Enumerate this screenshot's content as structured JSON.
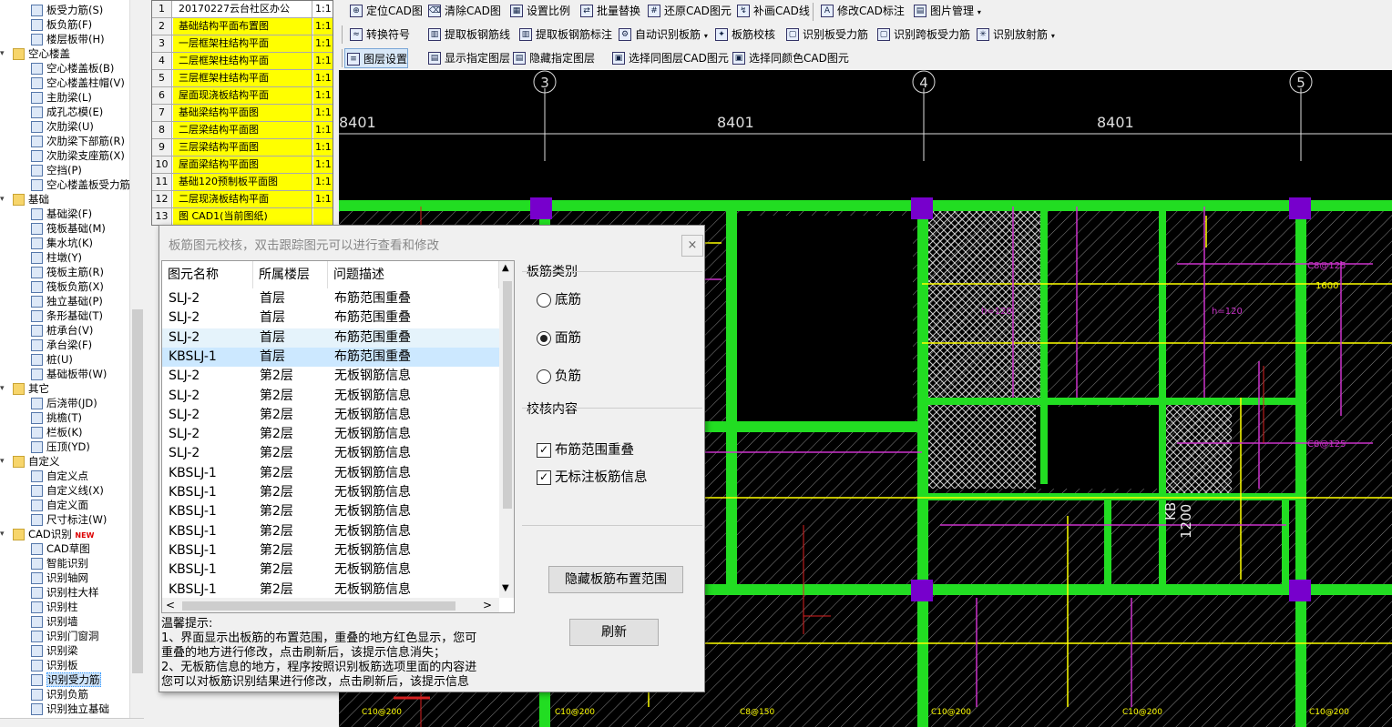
{
  "tree": [
    {
      "label": "板受力筋(S)",
      "indent": 2
    },
    {
      "label": "板负筋(F)",
      "indent": 2
    },
    {
      "label": "楼层板带(H)",
      "indent": 2
    },
    {
      "label": "空心楼盖",
      "indent": 1,
      "cat": true
    },
    {
      "label": "空心楼盖板(B)",
      "indent": 2
    },
    {
      "label": "空心楼盖柱帽(V)",
      "indent": 2
    },
    {
      "label": "主肋梁(L)",
      "indent": 2
    },
    {
      "label": "成孔芯模(E)",
      "indent": 2
    },
    {
      "label": "次肋梁(U)",
      "indent": 2
    },
    {
      "label": "次肋梁下部筋(R)",
      "indent": 2
    },
    {
      "label": "次肋梁支座筋(X)",
      "indent": 2
    },
    {
      "label": "空挡(P)",
      "indent": 2
    },
    {
      "label": "空心楼盖板受力筋",
      "indent": 2
    },
    {
      "label": "基础",
      "indent": 1,
      "cat": true
    },
    {
      "label": "基础梁(F)",
      "indent": 2
    },
    {
      "label": "筏板基础(M)",
      "indent": 2
    },
    {
      "label": "集水坑(K)",
      "indent": 2
    },
    {
      "label": "柱墩(Y)",
      "indent": 2
    },
    {
      "label": "筏板主筋(R)",
      "indent": 2
    },
    {
      "label": "筏板负筋(X)",
      "indent": 2
    },
    {
      "label": "独立基础(P)",
      "indent": 2
    },
    {
      "label": "条形基础(T)",
      "indent": 2
    },
    {
      "label": "桩承台(V)",
      "indent": 2
    },
    {
      "label": "承台梁(F)",
      "indent": 2
    },
    {
      "label": "桩(U)",
      "indent": 2
    },
    {
      "label": "基础板带(W)",
      "indent": 2
    },
    {
      "label": "其它",
      "indent": 1,
      "cat": true
    },
    {
      "label": "后浇带(JD)",
      "indent": 2
    },
    {
      "label": "挑檐(T)",
      "indent": 2
    },
    {
      "label": "栏板(K)",
      "indent": 2
    },
    {
      "label": "压顶(YD)",
      "indent": 2
    },
    {
      "label": "自定义",
      "indent": 1,
      "cat": true
    },
    {
      "label": "自定义点",
      "indent": 2
    },
    {
      "label": "自定义线(X)",
      "indent": 2
    },
    {
      "label": "自定义面",
      "indent": 2
    },
    {
      "label": "尺寸标注(W)",
      "indent": 2
    },
    {
      "label": "CAD识别",
      "indent": 1,
      "cat": true,
      "badge": "NEW"
    },
    {
      "label": "CAD草图",
      "indent": 2
    },
    {
      "label": "智能识别",
      "indent": 2
    },
    {
      "label": "识别轴网",
      "indent": 2
    },
    {
      "label": "识别柱大样",
      "indent": 2
    },
    {
      "label": "识别柱",
      "indent": 2
    },
    {
      "label": "识别墙",
      "indent": 2
    },
    {
      "label": "识别门窗洞",
      "indent": 2
    },
    {
      "label": "识别梁",
      "indent": 2
    },
    {
      "label": "识别板",
      "indent": 2
    },
    {
      "label": "识别受力筋",
      "indent": 2,
      "selected": true
    },
    {
      "label": "识别负筋",
      "indent": 2
    },
    {
      "label": "识别独立基础",
      "indent": 2
    }
  ],
  "drawings": [
    {
      "n": "1",
      "name": "20170227云台社区办公",
      "scale": "1:1",
      "header": true
    },
    {
      "n": "2",
      "name": "基础结构平面布置图",
      "scale": "1:1"
    },
    {
      "n": "3",
      "name": "一层框架柱结构平面",
      "scale": "1:1"
    },
    {
      "n": "4",
      "name": "二层框架柱结构平面",
      "scale": "1:1"
    },
    {
      "n": "5",
      "name": "三层框架柱结构平面",
      "scale": "1:1"
    },
    {
      "n": "6",
      "name": "屋面现浇板结构平面",
      "scale": "1:1"
    },
    {
      "n": "7",
      "name": "基础梁结构平面图",
      "scale": "1:1"
    },
    {
      "n": "8",
      "name": "二层梁结构平面图",
      "scale": "1:1"
    },
    {
      "n": "9",
      "name": "三层梁结构平面图",
      "scale": "1:1"
    },
    {
      "n": "10",
      "name": "屋面梁结构平面图",
      "scale": "1:1"
    },
    {
      "n": "11",
      "name": "基础120预制板平面图",
      "scale": "1:1"
    },
    {
      "n": "12",
      "name": "二层现浇板结构平面",
      "scale": "1:1"
    },
    {
      "n": "13",
      "name": "图 CAD1(当前图纸)",
      "scale": ""
    }
  ],
  "toolbar": {
    "row1": [
      "定位CAD图",
      "清除CAD图",
      "设置比例",
      "批量替换",
      "还原CAD图元",
      "补画CAD线",
      "修改CAD标注",
      "图片管理"
    ],
    "row2": [
      "转换符号",
      "提取板钢筋线",
      "提取板钢筋标注",
      "自动识别板筋",
      "板筋校核",
      "识别板受力筋",
      "识别跨板受力筋",
      "识别放射筋"
    ],
    "row3": [
      "图层设置",
      "显示指定图层",
      "隐藏指定图层",
      "选择同图层CAD图元",
      "选择同颜色CAD图元"
    ]
  },
  "cad": {
    "axes": [
      "3",
      "4",
      "5"
    ],
    "dims": [
      "8401",
      "8401",
      "8401"
    ],
    "labels": [
      "h=120",
      "h=120",
      "C8@125",
      "C8@125",
      "1600",
      "KB",
      "1200",
      "C10@200",
      "C10@200",
      "C8@150",
      "C10@200",
      "C10@200",
      "C10@200"
    ]
  },
  "dialog": {
    "title": "板筋图元校核，双击跟踪图元可以进行查看和修改",
    "close": "×",
    "columns": [
      "图元名称",
      "所属楼层",
      "问题描述"
    ],
    "rows": [
      [
        "SLJ-2",
        "首层",
        "布筋范围重叠"
      ],
      [
        "SLJ-2",
        "首层",
        "布筋范围重叠"
      ],
      [
        "SLJ-2",
        "首层",
        "布筋范围重叠"
      ],
      [
        "KBSLJ-1",
        "首层",
        "布筋范围重叠"
      ],
      [
        "SLJ-2",
        "第2层",
        "无板钢筋信息"
      ],
      [
        "SLJ-2",
        "第2层",
        "无板钢筋信息"
      ],
      [
        "SLJ-2",
        "第2层",
        "无板钢筋信息"
      ],
      [
        "SLJ-2",
        "第2层",
        "无板钢筋信息"
      ],
      [
        "SLJ-2",
        "第2层",
        "无板钢筋信息"
      ],
      [
        "KBSLJ-1",
        "第2层",
        "无板钢筋信息"
      ],
      [
        "KBSLJ-1",
        "第2层",
        "无板钢筋信息"
      ],
      [
        "KBSLJ-1",
        "第2层",
        "无板钢筋信息"
      ],
      [
        "KBSLJ-1",
        "第2层",
        "无板钢筋信息"
      ],
      [
        "KBSLJ-1",
        "第2层",
        "无板钢筋信息"
      ],
      [
        "KBSLJ-1",
        "第2层",
        "无板钢筋信息"
      ],
      [
        "KBSLJ-1",
        "第2层",
        "无板钢筋信息"
      ]
    ],
    "type_group": "板筋类别",
    "types": [
      "底筋",
      "面筋",
      "负筋"
    ],
    "selected_type": "面筋",
    "check_group": "校核内容",
    "checks": [
      "布筋范围重叠",
      "无标注板筋信息"
    ],
    "hide_btn": "隐藏板筋布置范围",
    "refresh_btn": "刷新",
    "tip_title": "温馨提示:",
    "tips": [
      "1、界面显示出板筋的布置范围，重叠的地方红色显示，您可",
      "重叠的地方进行修改，点击刷新后，该提示信息消失；",
      "2、无板筋信息的地方，程序按照识别板筋选项里面的内容进",
      "您可以对板筋识别结果进行修改，点击刷新后，该提示信息"
    ]
  },
  "colors": {
    "green": "#22dd22",
    "yellow": "#ffff00",
    "magenta": "#cc33cc",
    "purple": "#7700cc",
    "cad_bg": "#000000"
  }
}
